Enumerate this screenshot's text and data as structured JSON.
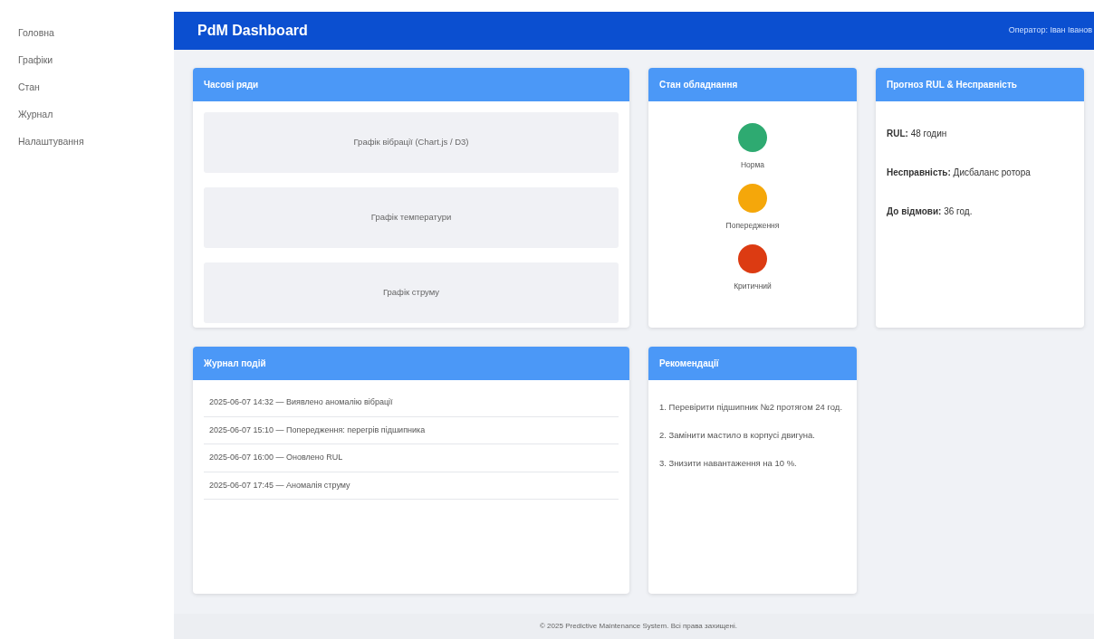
{
  "sidebar": {
    "items": [
      {
        "label": "Головна"
      },
      {
        "label": "Графіки"
      },
      {
        "label": "Стан"
      },
      {
        "label": "Журнал"
      },
      {
        "label": "Налаштування"
      }
    ]
  },
  "header": {
    "title": "PdM Dashboard",
    "operator": "Оператор: Іван Іванов"
  },
  "time_series": {
    "title": "Часові ряди",
    "charts": [
      "Графік вібрації (Chart.js / D3)",
      "Графік температури",
      "Графік струму"
    ]
  },
  "equipment_state": {
    "title": "Стан обладнання",
    "states": [
      {
        "label": "Норма",
        "color": "#2eaa71"
      },
      {
        "label": "Попередження",
        "color": "#f5a70a"
      },
      {
        "label": "Критичний",
        "color": "#dc3b12"
      }
    ]
  },
  "forecast": {
    "title": "Прогноз RUL & Несправність",
    "lines": [
      "**RUL:** 48 годин",
      "**Несправність:** Дисбаланс ротора",
      "**До відмови:** 36 год."
    ]
  },
  "event_log": {
    "title": "Журнал подій",
    "events": [
      "2025-06-07 14:32 — Виявлено аномалію вібрації",
      "2025-06-07 15:10 — Попередження: перегрів підшипника",
      "2025-06-07 16:00 — Оновлено RUL",
      "2025-06-07 17:45 — Аномалія струму"
    ]
  },
  "recommendations": {
    "title": "Рекомендації",
    "items": [
      "1. Перевірити підшипник №2 протягом 24 год.",
      "2. Замінити мастило в корпусі двигуна.",
      "3. Знизити навантаження на 10 %."
    ]
  },
  "footer": {
    "text": "© 2025 Predictive Maintenance System. Всі права захищені."
  }
}
